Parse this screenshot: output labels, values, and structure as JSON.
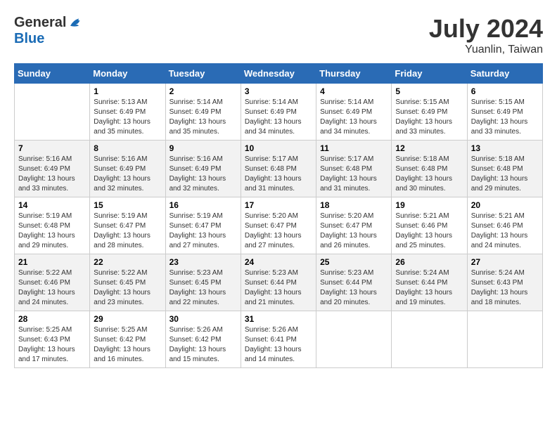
{
  "logo": {
    "general": "General",
    "blue": "Blue"
  },
  "title": {
    "month_year": "July 2024",
    "location": "Yuanlin, Taiwan"
  },
  "days_of_week": [
    "Sunday",
    "Monday",
    "Tuesday",
    "Wednesday",
    "Thursday",
    "Friday",
    "Saturday"
  ],
  "weeks": [
    [
      {
        "day": "",
        "sunrise": "",
        "sunset": "",
        "daylight": ""
      },
      {
        "day": "1",
        "sunrise": "Sunrise: 5:13 AM",
        "sunset": "Sunset: 6:49 PM",
        "daylight": "Daylight: 13 hours and 35 minutes."
      },
      {
        "day": "2",
        "sunrise": "Sunrise: 5:14 AM",
        "sunset": "Sunset: 6:49 PM",
        "daylight": "Daylight: 13 hours and 35 minutes."
      },
      {
        "day": "3",
        "sunrise": "Sunrise: 5:14 AM",
        "sunset": "Sunset: 6:49 PM",
        "daylight": "Daylight: 13 hours and 34 minutes."
      },
      {
        "day": "4",
        "sunrise": "Sunrise: 5:14 AM",
        "sunset": "Sunset: 6:49 PM",
        "daylight": "Daylight: 13 hours and 34 minutes."
      },
      {
        "day": "5",
        "sunrise": "Sunrise: 5:15 AM",
        "sunset": "Sunset: 6:49 PM",
        "daylight": "Daylight: 13 hours and 33 minutes."
      },
      {
        "day": "6",
        "sunrise": "Sunrise: 5:15 AM",
        "sunset": "Sunset: 6:49 PM",
        "daylight": "Daylight: 13 hours and 33 minutes."
      }
    ],
    [
      {
        "day": "7",
        "sunrise": "Sunrise: 5:16 AM",
        "sunset": "Sunset: 6:49 PM",
        "daylight": "Daylight: 13 hours and 33 minutes."
      },
      {
        "day": "8",
        "sunrise": "Sunrise: 5:16 AM",
        "sunset": "Sunset: 6:49 PM",
        "daylight": "Daylight: 13 hours and 32 minutes."
      },
      {
        "day": "9",
        "sunrise": "Sunrise: 5:16 AM",
        "sunset": "Sunset: 6:49 PM",
        "daylight": "Daylight: 13 hours and 32 minutes."
      },
      {
        "day": "10",
        "sunrise": "Sunrise: 5:17 AM",
        "sunset": "Sunset: 6:48 PM",
        "daylight": "Daylight: 13 hours and 31 minutes."
      },
      {
        "day": "11",
        "sunrise": "Sunrise: 5:17 AM",
        "sunset": "Sunset: 6:48 PM",
        "daylight": "Daylight: 13 hours and 31 minutes."
      },
      {
        "day": "12",
        "sunrise": "Sunrise: 5:18 AM",
        "sunset": "Sunset: 6:48 PM",
        "daylight": "Daylight: 13 hours and 30 minutes."
      },
      {
        "day": "13",
        "sunrise": "Sunrise: 5:18 AM",
        "sunset": "Sunset: 6:48 PM",
        "daylight": "Daylight: 13 hours and 29 minutes."
      }
    ],
    [
      {
        "day": "14",
        "sunrise": "Sunrise: 5:19 AM",
        "sunset": "Sunset: 6:48 PM",
        "daylight": "Daylight: 13 hours and 29 minutes."
      },
      {
        "day": "15",
        "sunrise": "Sunrise: 5:19 AM",
        "sunset": "Sunset: 6:47 PM",
        "daylight": "Daylight: 13 hours and 28 minutes."
      },
      {
        "day": "16",
        "sunrise": "Sunrise: 5:19 AM",
        "sunset": "Sunset: 6:47 PM",
        "daylight": "Daylight: 13 hours and 27 minutes."
      },
      {
        "day": "17",
        "sunrise": "Sunrise: 5:20 AM",
        "sunset": "Sunset: 6:47 PM",
        "daylight": "Daylight: 13 hours and 27 minutes."
      },
      {
        "day": "18",
        "sunrise": "Sunrise: 5:20 AM",
        "sunset": "Sunset: 6:47 PM",
        "daylight": "Daylight: 13 hours and 26 minutes."
      },
      {
        "day": "19",
        "sunrise": "Sunrise: 5:21 AM",
        "sunset": "Sunset: 6:46 PM",
        "daylight": "Daylight: 13 hours and 25 minutes."
      },
      {
        "day": "20",
        "sunrise": "Sunrise: 5:21 AM",
        "sunset": "Sunset: 6:46 PM",
        "daylight": "Daylight: 13 hours and 24 minutes."
      }
    ],
    [
      {
        "day": "21",
        "sunrise": "Sunrise: 5:22 AM",
        "sunset": "Sunset: 6:46 PM",
        "daylight": "Daylight: 13 hours and 24 minutes."
      },
      {
        "day": "22",
        "sunrise": "Sunrise: 5:22 AM",
        "sunset": "Sunset: 6:45 PM",
        "daylight": "Daylight: 13 hours and 23 minutes."
      },
      {
        "day": "23",
        "sunrise": "Sunrise: 5:23 AM",
        "sunset": "Sunset: 6:45 PM",
        "daylight": "Daylight: 13 hours and 22 minutes."
      },
      {
        "day": "24",
        "sunrise": "Sunrise: 5:23 AM",
        "sunset": "Sunset: 6:44 PM",
        "daylight": "Daylight: 13 hours and 21 minutes."
      },
      {
        "day": "25",
        "sunrise": "Sunrise: 5:23 AM",
        "sunset": "Sunset: 6:44 PM",
        "daylight": "Daylight: 13 hours and 20 minutes."
      },
      {
        "day": "26",
        "sunrise": "Sunrise: 5:24 AM",
        "sunset": "Sunset: 6:44 PM",
        "daylight": "Daylight: 13 hours and 19 minutes."
      },
      {
        "day": "27",
        "sunrise": "Sunrise: 5:24 AM",
        "sunset": "Sunset: 6:43 PM",
        "daylight": "Daylight: 13 hours and 18 minutes."
      }
    ],
    [
      {
        "day": "28",
        "sunrise": "Sunrise: 5:25 AM",
        "sunset": "Sunset: 6:43 PM",
        "daylight": "Daylight: 13 hours and 17 minutes."
      },
      {
        "day": "29",
        "sunrise": "Sunrise: 5:25 AM",
        "sunset": "Sunset: 6:42 PM",
        "daylight": "Daylight: 13 hours and 16 minutes."
      },
      {
        "day": "30",
        "sunrise": "Sunrise: 5:26 AM",
        "sunset": "Sunset: 6:42 PM",
        "daylight": "Daylight: 13 hours and 15 minutes."
      },
      {
        "day": "31",
        "sunrise": "Sunrise: 5:26 AM",
        "sunset": "Sunset: 6:41 PM",
        "daylight": "Daylight: 13 hours and 14 minutes."
      },
      {
        "day": "",
        "sunrise": "",
        "sunset": "",
        "daylight": ""
      },
      {
        "day": "",
        "sunrise": "",
        "sunset": "",
        "daylight": ""
      },
      {
        "day": "",
        "sunrise": "",
        "sunset": "",
        "daylight": ""
      }
    ]
  ]
}
